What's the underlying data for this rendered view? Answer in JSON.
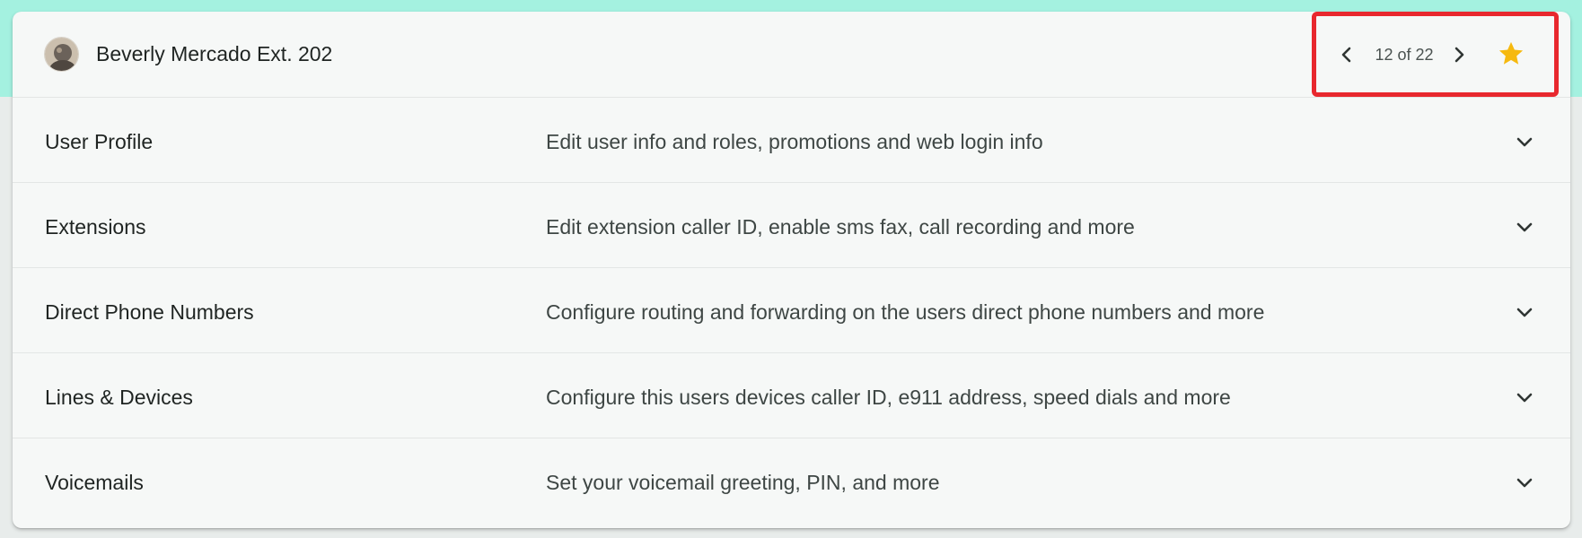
{
  "header": {
    "user_name": "Beverly Mercado Ext. 202",
    "avatar_icon": "user-avatar-photo",
    "pager": {
      "text": "12 of 22",
      "prev_icon": "chevron-left-icon",
      "next_icon": "chevron-right-icon"
    },
    "favorite_icon": "star-icon",
    "favorite_color": "#f6b90f",
    "highlight_color": "#e8282e"
  },
  "rows": [
    {
      "title": "User Profile",
      "description": "Edit user info and roles, promotions and web login info"
    },
    {
      "title": "Extensions",
      "description": "Edit extension caller ID, enable sms fax, call recording and more"
    },
    {
      "title": "Direct Phone Numbers",
      "description": "Configure routing and forwarding on the users direct phone numbers and more"
    },
    {
      "title": "Lines & Devices",
      "description": "Configure this users devices caller ID, e911 address, speed dials and more"
    },
    {
      "title": "Voicemails",
      "description": "Set your voicemail greeting, PIN, and more"
    }
  ],
  "colors": {
    "top_band": "#a4f1e0",
    "card_background": "#f6f8f7"
  }
}
